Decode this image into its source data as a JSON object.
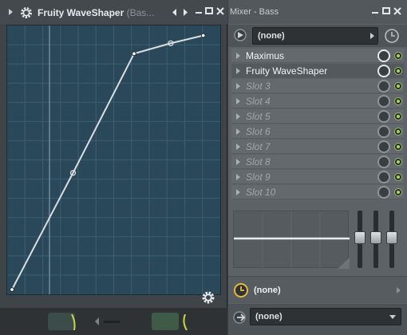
{
  "waveshaper": {
    "title": "Fruity WaveShaper",
    "title_suffix": "(Bas...",
    "curve_points": [
      [
        0.0,
        0.0
      ],
      [
        0.3,
        0.45
      ],
      [
        0.6,
        0.91
      ],
      [
        0.78,
        0.95
      ],
      [
        0.94,
        0.98
      ]
    ],
    "colors": {
      "graph_bg": "#2b485b",
      "grid": "#3b5e73",
      "curve": "#d9dde0"
    }
  },
  "mixer": {
    "title": "Mixer - Bass",
    "preset": "(none)",
    "slots": [
      {
        "label": "Maximus",
        "state": "filled"
      },
      {
        "label": "Fruity WaveShaper",
        "state": "filled",
        "active": true
      },
      {
        "label": "Slot 3",
        "state": "empty"
      },
      {
        "label": "Slot 4",
        "state": "empty"
      },
      {
        "label": "Slot 5",
        "state": "empty"
      },
      {
        "label": "Slot 6",
        "state": "empty"
      },
      {
        "label": "Slot 7",
        "state": "empty"
      },
      {
        "label": "Slot 8",
        "state": "empty"
      },
      {
        "label": "Slot 9",
        "state": "empty"
      },
      {
        "label": "Slot 10",
        "state": "empty"
      }
    ],
    "time_value": "(none)",
    "output_value": "(none)",
    "colors": {
      "led_on": "#9fe24d",
      "clock": "#e8b640"
    }
  }
}
